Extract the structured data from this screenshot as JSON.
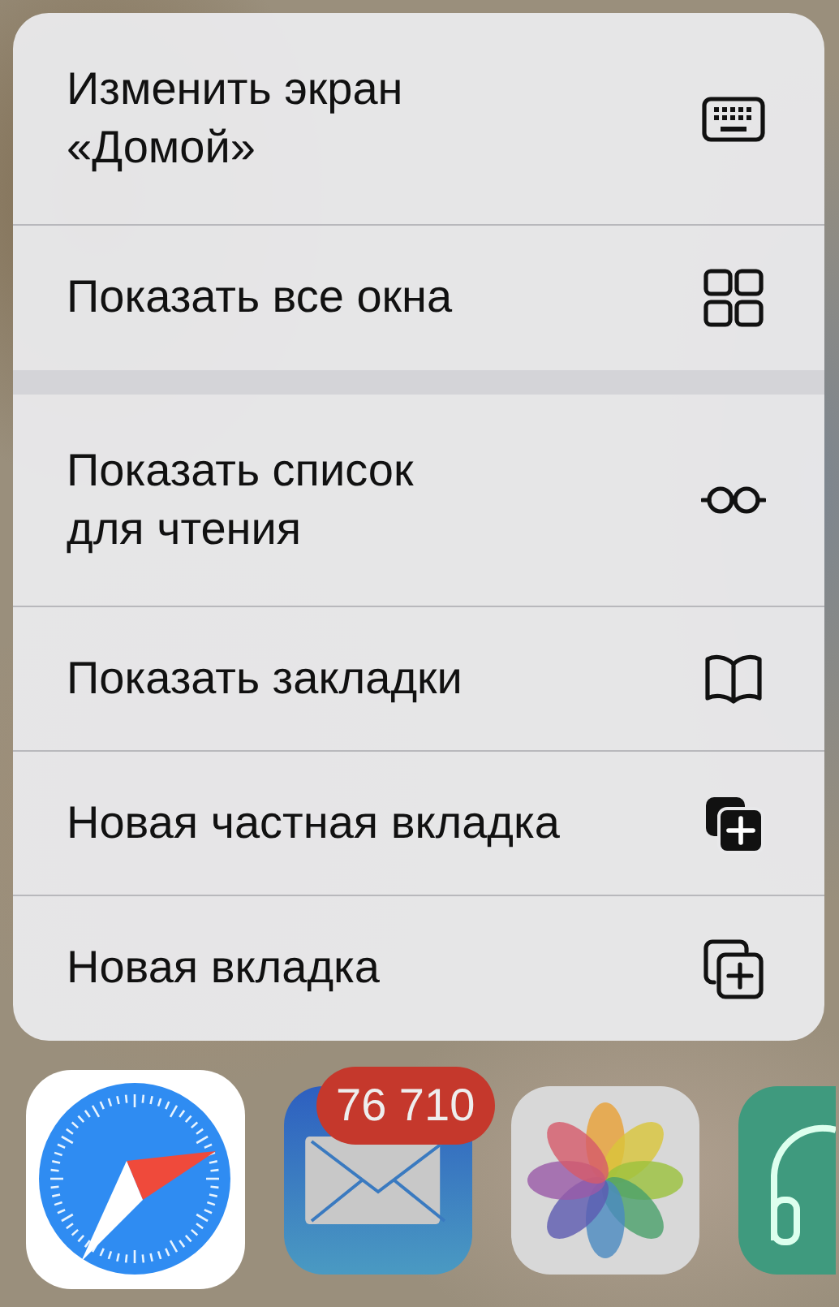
{
  "menu": {
    "sections": [
      {
        "items": [
          {
            "label": "Изменить экран\n«Домой»",
            "kind": "keyboard"
          },
          {
            "label": "Показать все окна",
            "kind": "grid"
          }
        ]
      },
      {
        "items": [
          {
            "label": "Показать список\nдля чтения",
            "kind": "glasses"
          },
          {
            "label": "Показать закладки",
            "kind": "book"
          },
          {
            "label": "Новая частная вкладка",
            "kind": "private-tab"
          },
          {
            "label": "Новая вкладка",
            "kind": "new-tab"
          }
        ]
      }
    ]
  },
  "dock": {
    "apps": [
      {
        "kind": "safari"
      },
      {
        "kind": "mail",
        "badge": "76 710"
      },
      {
        "kind": "photos"
      },
      {
        "kind": "partial"
      }
    ]
  }
}
